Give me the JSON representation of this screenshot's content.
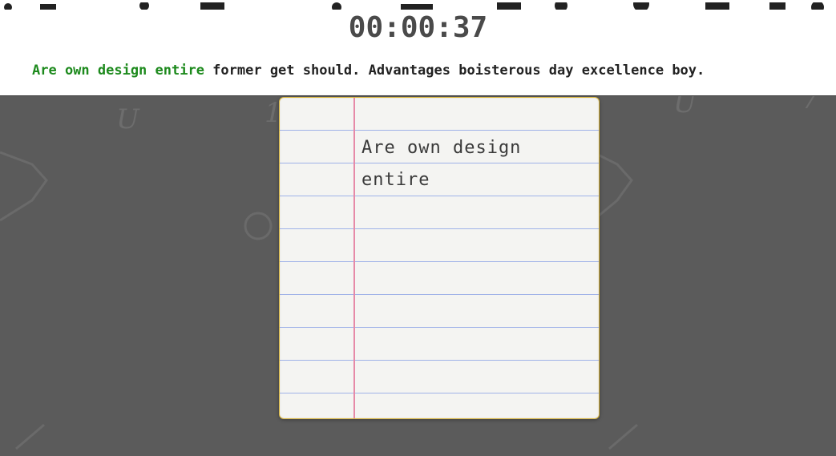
{
  "timer": {
    "value": "00:00:37"
  },
  "prompt": {
    "typed": "Are own design entire",
    "remaining": " former get should. Advantages boisterous day excellence boy."
  },
  "paper": {
    "text": "Are own design entire"
  },
  "colors": {
    "background": "#5b5b5b",
    "header": "#ffffff",
    "typed_text": "#1d8a1d",
    "paper": "#f4f4f2",
    "ruled_line": "#9fb2e8",
    "margin_line": "#e68aa8",
    "paper_border": "#d8b43a"
  }
}
